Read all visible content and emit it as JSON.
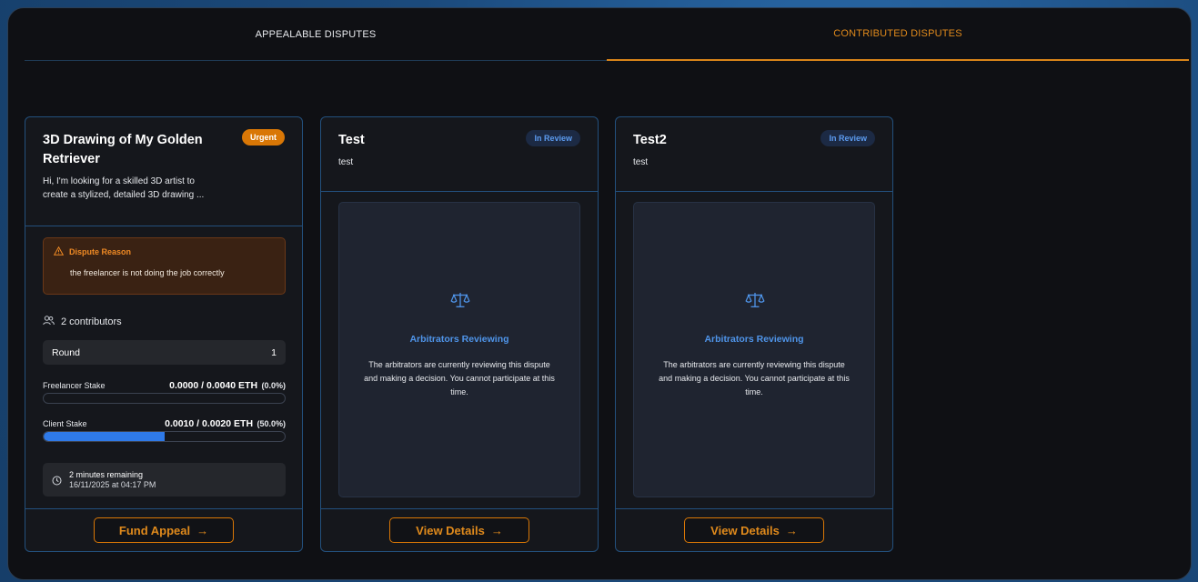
{
  "tabs": {
    "appealable": "APPEALABLE DISPUTES",
    "contributed": "CONTRIBUTED DISPUTES"
  },
  "colors": {
    "accent": "#d97706",
    "review_blue": "#4f95ea",
    "progress_fill": "#2f7ae8",
    "background": "#0f1014"
  },
  "cards": [
    {
      "title_line1": "3D Drawing of My Golden",
      "title_line2": "Retriever",
      "desc_line1": "Hi, I'm looking for a skilled 3D artist to",
      "desc_line2": "create a stylized, detailed 3D drawing ...",
      "badge": "Urgent",
      "dispute_reason_label": "Dispute Reason",
      "dispute_reason_text": "the freelancer is not doing the job correctly",
      "contributors": "2 contributors",
      "round_label": "Round",
      "round_value": "1",
      "freelancer_stake_label": "Freelancer Stake",
      "freelancer_stake_value": "0.0000 / 0.0040 ETH",
      "freelancer_stake_pct": "(0.0%)",
      "freelancer_stake_fraction": 0.0,
      "client_stake_label": "Client Stake",
      "client_stake_value": "0.0010 / 0.0020 ETH",
      "client_stake_pct": "(50.0%)",
      "client_stake_fraction": 0.5,
      "time_remaining": "2 minutes remaining",
      "deadline": "16/11/2025 at 04:17 PM",
      "button_label": "Fund Appeal",
      "button_arrow": "→"
    },
    {
      "title": "Test",
      "desc": "test",
      "badge": "In Review",
      "review_title": "Arbitrators Reviewing",
      "review_text_line1": "The arbitrators are currently reviewing this dispute",
      "review_text_line2": "and making a decision. You cannot participate at this",
      "review_text_line3": "time.",
      "button_label": "View Details",
      "button_arrow": "→"
    },
    {
      "title": "Test2",
      "desc": "test",
      "badge": "In Review",
      "review_title": "Arbitrators Reviewing",
      "review_text_line1": "The arbitrators are currently reviewing this dispute",
      "review_text_line2": "and making a decision. You cannot participate at this",
      "review_text_line3": "time.",
      "button_label": "View Details",
      "button_arrow": "→"
    }
  ]
}
